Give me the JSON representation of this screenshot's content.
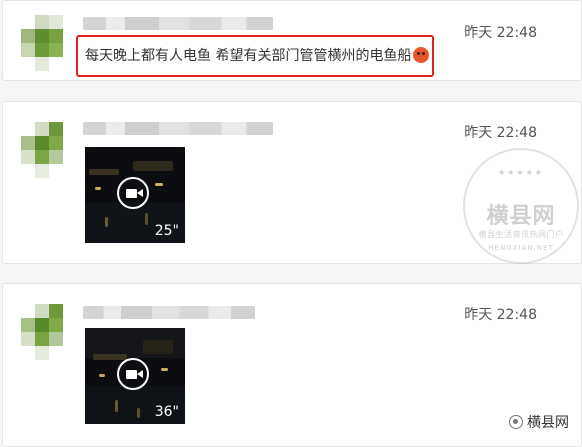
{
  "messages": [
    {
      "time": "昨天 22:48",
      "text": "每天晚上都有人电鱼 希望有关部门管管横州的电鱼船",
      "emoji": "angry-face-emoji",
      "highlight_color": "#e0201c"
    },
    {
      "time": "昨天 22:48",
      "video_duration": "25\""
    },
    {
      "time": "昨天 22:48",
      "video_duration": "36\""
    }
  ],
  "watermark": {
    "main": "横县网",
    "sub": "横县生活资讯热网门户",
    "en": "HENGXIAN.NET",
    "stars": "★★★★★"
  },
  "brand": {
    "label": "横县网",
    "icon": "wechat-channel-icon"
  },
  "colors": {
    "page_bg": "#f5f5f5",
    "card_bg": "#ffffff",
    "highlight": "#e0201c",
    "avatar_green": "#6e9a3a"
  }
}
